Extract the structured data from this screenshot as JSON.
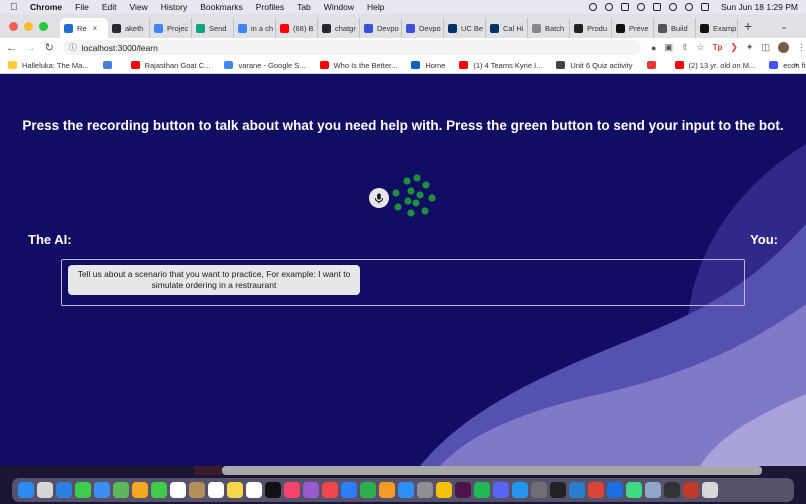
{
  "menubar": {
    "app": "Chrome",
    "items": [
      "File",
      "Edit",
      "View",
      "History",
      "Bookmarks",
      "Profiles",
      "Tab",
      "Window",
      "Help"
    ],
    "clock": "Sun Jun 18  1:29 PM"
  },
  "tabs": [
    {
      "label": "Re",
      "color": "#1f6fd1",
      "active": true
    },
    {
      "label": "aketh",
      "color": "#24292f"
    },
    {
      "label": "Projec",
      "color": "#4285f4"
    },
    {
      "label": "Send",
      "color": "#10a37f"
    },
    {
      "label": "in a ch",
      "color": "#4285f4"
    },
    {
      "label": "(68) B",
      "color": "#ff0000"
    },
    {
      "label": "chatgr",
      "color": "#24292f"
    },
    {
      "label": "Devpo",
      "color": "#3b4fd9"
    },
    {
      "label": "Devpo",
      "color": "#3b4fd9"
    },
    {
      "label": "UC Be",
      "color": "#003262"
    },
    {
      "label": "Cal Hi",
      "color": "#003262"
    },
    {
      "label": "Batch",
      "color": "#888888"
    },
    {
      "label": "Produ",
      "color": "#222222"
    },
    {
      "label": "Preve",
      "color": "#111111"
    },
    {
      "label": "Build",
      "color": "#555555"
    },
    {
      "label": "Examp",
      "color": "#111111"
    }
  ],
  "toolbar": {
    "url": "localhost:3000/learn"
  },
  "bookmarks": [
    {
      "label": "Halleluka: The Ma...",
      "color": "#ffcc33"
    },
    {
      "label": "",
      "color": "#4a7de0"
    },
    {
      "label": "Rajasthan Goat C...",
      "color": "#ff0000"
    },
    {
      "label": "varane - Google S...",
      "color": "#4285f4"
    },
    {
      "label": "Who Is the Better...",
      "color": "#ff0000"
    },
    {
      "label": "Home",
      "color": "#0a66c2"
    },
    {
      "label": "(1) 4 Teams Kyrie I...",
      "color": "#ff0000"
    },
    {
      "label": "Unit 6 Quiz activity",
      "color": "#444444"
    },
    {
      "label": "",
      "color": "#e53935"
    },
    {
      "label": "(2) 13 yr. old on M...",
      "color": "#ff0000"
    },
    {
      "label": "econ final Flashca...",
      "color": "#4255ff"
    }
  ],
  "page": {
    "instructions": "Press the recording button to talk about what you need help with. Press the green button to send your input to the bot.",
    "ai_label": "The AI:",
    "you_label": "You:",
    "ai_message": "Tell us about a scenario that you want to practice, For example: I want to simulate ordering in a restraurant",
    "mic_icon": "microphone-icon",
    "loading_icon": "loading-spinner-icon"
  },
  "dock_icons": [
    "finder",
    "launchpad",
    "safari",
    "messages",
    "mail",
    "maps",
    "photos",
    "facetime",
    "calendar",
    "contacts",
    "reminders",
    "notes",
    "freeform",
    "tv",
    "music",
    "podcasts",
    "news",
    "keynote",
    "numbers",
    "pages",
    "app-store",
    "system-settings",
    "chrome-canary",
    "slack",
    "spotify",
    "discord",
    "docker",
    "help",
    "terminal",
    "vscode",
    "chrome",
    "xcode",
    "android-studio",
    "preview",
    "trash-area",
    "dictionary",
    "trash"
  ]
}
